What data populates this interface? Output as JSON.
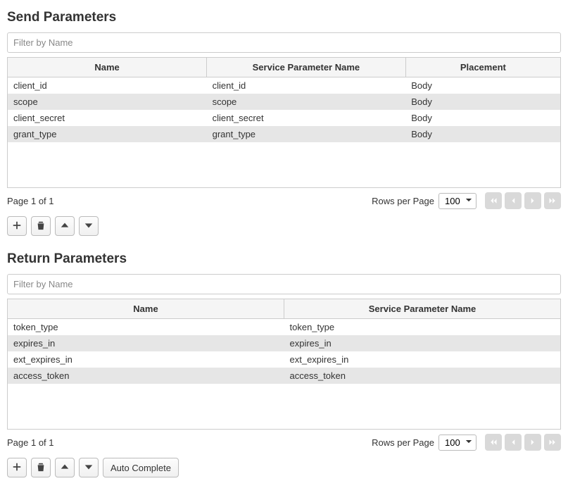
{
  "send": {
    "title": "Send Parameters",
    "filter_placeholder": "Filter by Name",
    "columns": [
      "Name",
      "Service Parameter Name",
      "Placement"
    ],
    "rows": [
      {
        "name": "client_id",
        "sp": "client_id",
        "place": "Body"
      },
      {
        "name": "scope",
        "sp": "scope",
        "place": "Body"
      },
      {
        "name": "client_secret",
        "sp": "client_secret",
        "place": "Body"
      },
      {
        "name": "grant_type",
        "sp": "grant_type",
        "place": "Body"
      }
    ],
    "page_text": "Page 1 of 1",
    "rows_per_page_label": "Rows per Page",
    "rows_per_page_value": "100"
  },
  "return": {
    "title": "Return Parameters",
    "filter_placeholder": "Filter by Name",
    "columns": [
      "Name",
      "Service Parameter Name"
    ],
    "rows": [
      {
        "name": "token_type",
        "sp": "token_type"
      },
      {
        "name": "expires_in",
        "sp": "expires_in"
      },
      {
        "name": "ext_expires_in",
        "sp": "ext_expires_in"
      },
      {
        "name": "access_token",
        "sp": "access_token"
      }
    ],
    "page_text": "Page 1 of 1",
    "rows_per_page_label": "Rows per Page",
    "rows_per_page_value": "100"
  },
  "buttons": {
    "auto_complete": "Auto Complete"
  }
}
